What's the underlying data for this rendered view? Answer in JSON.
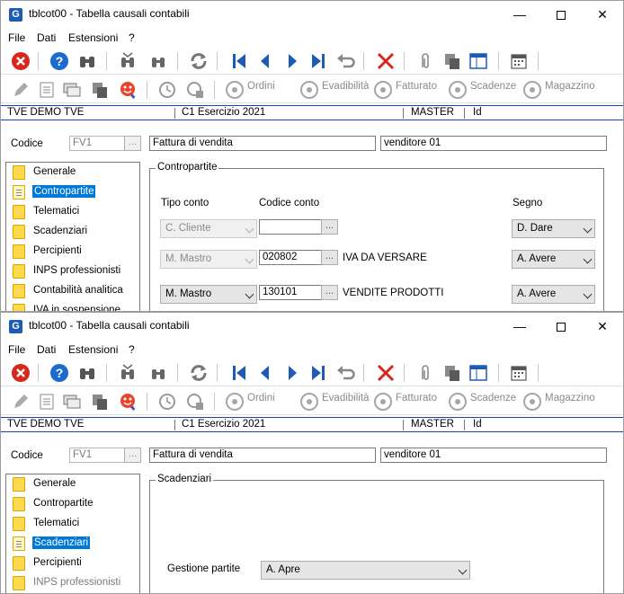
{
  "windows": [
    {
      "title": "tblcot00 - Tabella causali contabili",
      "menu": [
        "File",
        "Dati",
        "Estensioni",
        "?"
      ],
      "toolbar2_labels": [
        "Ordini",
        "Evadibilità",
        "Fatturato",
        "Scadenze",
        "Magazzino"
      ],
      "status": {
        "company": "TVE DEMO TVE",
        "year": "C1 Esercizio 2021",
        "user": "MASTER",
        "id": "Id"
      },
      "form": {
        "codice_label": "Codice",
        "codice_value": "FV1",
        "lookup_btn": "...",
        "description": "Fattura di vendita",
        "agent": "venditore 01"
      },
      "sidebar": [
        {
          "label": "Generale",
          "selected": false
        },
        {
          "label": "Contropartite",
          "selected": true
        },
        {
          "label": "Telematici",
          "selected": false
        },
        {
          "label": "Scadenziari",
          "selected": false
        },
        {
          "label": "Percipienti",
          "selected": false
        },
        {
          "label": "INPS professionisti",
          "selected": false
        },
        {
          "label": "Contabilità analitica",
          "selected": false
        },
        {
          "label": "IVA in sospensione",
          "selected": false
        }
      ],
      "panel": {
        "title": "Contropartite",
        "headers": {
          "tipo": "Tipo conto",
          "codice": "Codice conto",
          "segno": "Segno"
        },
        "rows": [
          {
            "tipo": "C. Cliente",
            "codice": "",
            "btn": "...",
            "descr": "",
            "segno": "D. Dare"
          },
          {
            "tipo": "M. Mastro",
            "codice": "020802",
            "btn": "...",
            "descr": "IVA DA VERSARE",
            "segno": "A. Avere"
          },
          {
            "tipo": "M. Mastro",
            "codice": "130101",
            "btn": "...",
            "descr": "VENDITE PRODOTTI",
            "segno": "A. Avere"
          }
        ]
      }
    },
    {
      "title": "tblcot00 - Tabella causali contabili",
      "menu": [
        "File",
        "Dati",
        "Estensioni",
        "?"
      ],
      "toolbar2_labels": [
        "Ordini",
        "Evadibilità",
        "Fatturato",
        "Scadenze",
        "Magazzino"
      ],
      "status": {
        "company": "TVE DEMO TVE",
        "year": "C1 Esercizio 2021",
        "user": "MASTER",
        "id": "Id"
      },
      "form": {
        "codice_label": "Codice",
        "codice_value": "FV1",
        "lookup_btn": "...",
        "description": "Fattura di vendita",
        "agent": "venditore 01"
      },
      "sidebar": [
        {
          "label": "Generale",
          "selected": false
        },
        {
          "label": "Contropartite",
          "selected": false
        },
        {
          "label": "Telematici",
          "selected": false
        },
        {
          "label": "Scadenziari",
          "selected": true
        },
        {
          "label": "Percipienti",
          "selected": false
        },
        {
          "label": "INPS professionisti",
          "selected": false
        }
      ],
      "panel": {
        "title": "Scadenziari",
        "gestione_label": "Gestione partite",
        "gestione_value": "A. Apre"
      }
    }
  ],
  "icons": {
    "close": "close-circle-red-icon",
    "help": "help-circle-blue-icon",
    "binoculars": "binoculars-icon",
    "refresh": "refresh-icon",
    "first": "first-record-icon",
    "prev": "previous-record-icon",
    "next": "next-record-icon",
    "last": "last-record-icon",
    "undo": "undo-icon",
    "delete": "delete-x-icon",
    "attach": "paperclip-icon",
    "copy": "copy-icon",
    "layout": "window-layout-icon",
    "calendar": "calendar-icon"
  },
  "colors": {
    "accent_blue": "#1e5bb5",
    "delete_red": "#d9261c",
    "selection": "#0078d7",
    "status_border": "#1a3fbf"
  }
}
